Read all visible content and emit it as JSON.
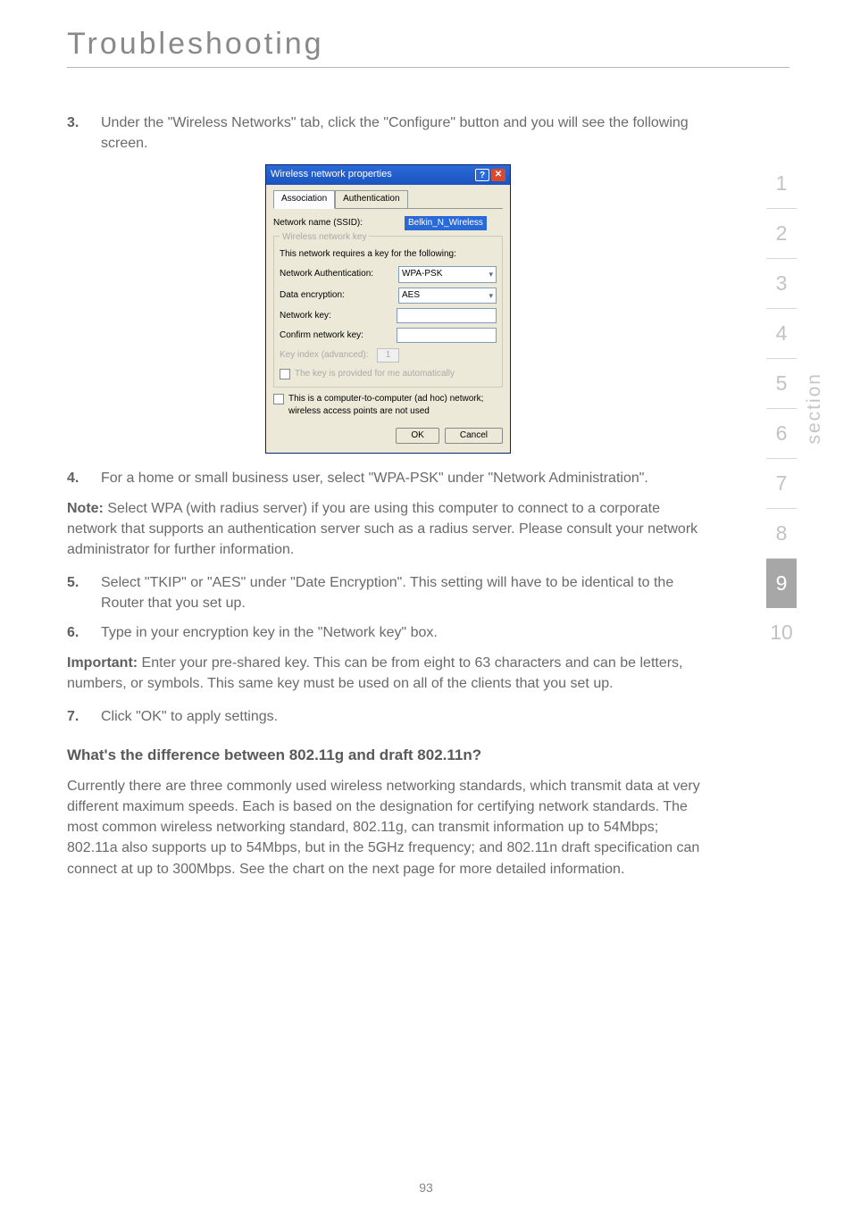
{
  "page": {
    "title": "Troubleshooting",
    "number": "93"
  },
  "sidebar": {
    "items": [
      "1",
      "2",
      "3",
      "4",
      "5",
      "6",
      "7",
      "8",
      "9",
      "10"
    ],
    "active_index": 8,
    "label": "section"
  },
  "steps": {
    "s3": {
      "num": "3.",
      "text": "Under the \"Wireless Networks\" tab, click the \"Configure\" button and you will see the following screen."
    },
    "s4": {
      "num": "4.",
      "text": "For a home or small business user, select \"WPA-PSK\" under \"Network Administration\"."
    },
    "s5": {
      "num": "5.",
      "text": "Select \"TKIP\" or \"AES\" under \"Date Encryption\". This setting will have to be identical to the Router that you set up."
    },
    "s6": {
      "num": "6.",
      "text": "Type in your encryption key in the \"Network key\" box."
    },
    "s7": {
      "num": "7.",
      "text": "Click \"OK\" to apply settings."
    }
  },
  "note": {
    "label": "Note:",
    "text": " Select WPA (with radius server) if you are using this computer to connect to a corporate network that supports an authentication server such as a radius server. Please consult your network administrator for further information."
  },
  "important": {
    "label": "Important:",
    "text": " Enter your pre-shared key. This can be from eight to 63 characters and can be letters, numbers, or symbols. This same key must be used on all of the clients that you set up."
  },
  "subheading": "What's the difference between 802.11g and draft 802.11n?",
  "lastpara": "Currently there are three commonly used wireless networking standards, which transmit data at very different maximum speeds. Each is based on the designation for certifying network standards. The most common wireless networking standard, 802.11g, can transmit information up to 54Mbps; 802.11a also supports up to 54Mbps, but in the 5GHz frequency; and 802.11n draft specification can connect at up to 300Mbps. See the chart on the next page for more detailed information.",
  "dialog": {
    "title": "Wireless network properties",
    "help_btn": "?",
    "close_btn": "✕",
    "tabs": {
      "assoc": "Association",
      "auth": "Authentication"
    },
    "ssid_label": "Network name (SSID):",
    "ssid_value": "Belkin_N_Wireless",
    "group_label": "Wireless network key",
    "group_hint": "This network requires a key for the following:",
    "auth_label": "Network Authentication:",
    "auth_value": "WPA-PSK",
    "enc_label": "Data encryption:",
    "enc_value": "AES",
    "netkey_label": "Network key:",
    "confirm_label": "Confirm network key:",
    "keyindex_label": "Key index (advanced):",
    "keyindex_value": "1",
    "autokey_label": "The key is provided for me automatically",
    "adhoc_label": "This is a computer-to-computer (ad hoc) network; wireless access points are not used",
    "ok": "OK",
    "cancel": "Cancel"
  }
}
